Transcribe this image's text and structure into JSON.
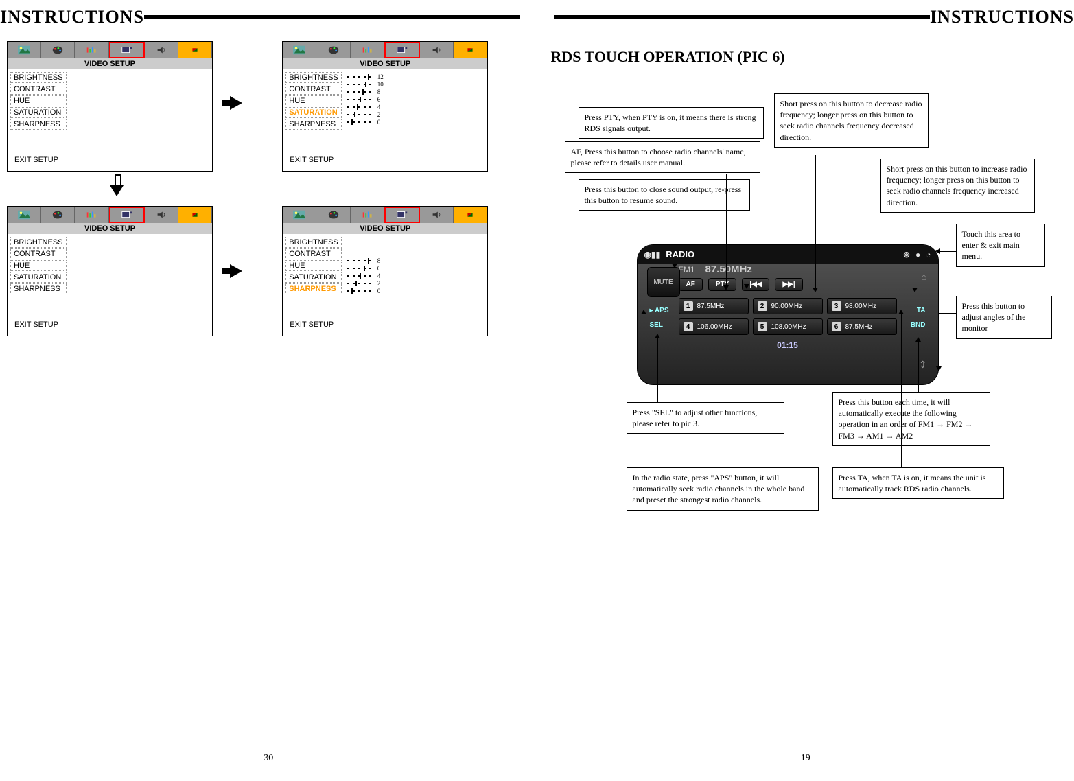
{
  "left": {
    "header": "INSTRUCTIONS",
    "page_num": "30",
    "panels": [
      {
        "title": "VIDEO SETUP",
        "items": [
          "BRIGHTNESS",
          "CONTRAST",
          "HUE",
          "SATURATION",
          "SHARPNESS"
        ],
        "selected": null,
        "exit": "EXIT SETUP",
        "bars": null
      },
      {
        "title": "VIDEO SETUP",
        "items": [
          "BRIGHTNESS",
          "CONTRAST",
          "HUE",
          "SATURATION",
          "SHARPNESS"
        ],
        "selected": 3,
        "exit": "EXIT SETUP",
        "bars": [
          "12",
          "10",
          "8",
          "6",
          "4",
          "2",
          "0"
        ]
      },
      {
        "title": "VIDEO SETUP",
        "items": [
          "BRIGHTNESS",
          "CONTRAST",
          "HUE",
          "SATURATION",
          "SHARPNESS"
        ],
        "selected": null,
        "exit": "EXIT SETUP",
        "bars": null
      },
      {
        "title": "VIDEO SETUP",
        "items": [
          "BRIGHTNESS",
          "CONTRAST",
          "HUE",
          "SATURATION",
          "SHARPNESS"
        ],
        "selected": 4,
        "exit": "EXIT SETUP",
        "bars": [
          "8",
          "6",
          "4",
          "2",
          "0"
        ]
      }
    ]
  },
  "right": {
    "header": "INSTRUCTIONS",
    "section_title": "RDS TOUCH OPERATION  (PIC 6)",
    "page_num": "19",
    "callouts": {
      "pty": "Press PTY, when PTY is on, it means there is strong RDS signals output.",
      "af": "AF, Press this button to choose radio channels' name, please refer to details user manual.",
      "mute": "Press this button to close sound output, re-press this button to resume sound.",
      "dec": "Short press on this button to decrease radio frequency; longer press on this button to seek radio channels frequency decreased direction.",
      "inc": "Short press on this button to increase radio frequency; longer press on this button to seek radio channels frequency increased direction.",
      "menu": "Touch this area to enter & exit main menu.",
      "angle": "Press this button to adjust angles of the monitor",
      "sel": "Press \"SEL\" to adjust other functions, please refer to pic 3.",
      "bnd": "Press this button each time, it will automatically execute the following operation in an order of FM1 → FM2 → FM3 → AM1 → AM2",
      "aps": "In the radio state, press \"APS\" button, it will automatically seek radio channels in the whole band and preset the strongest radio channels.",
      "ta": "Press TA, when TA is on, it means the unit is automatically track RDS radio channels."
    },
    "radio": {
      "title": "RADIO",
      "mute": "MUTE",
      "band": "FM1",
      "freq": "87.50MHz",
      "af": "AF",
      "pty": "PTY",
      "prev": "|◀◀",
      "next": "▶▶|",
      "aps": "APS",
      "sel": "SEL",
      "ta": "TA",
      "bnd": "BND",
      "clock": "01:15",
      "presets": [
        {
          "n": "1",
          "f": "87.5MHz"
        },
        {
          "n": "2",
          "f": "90.00MHz"
        },
        {
          "n": "3",
          "f": "98.00MHz"
        },
        {
          "n": "4",
          "f": "106.00MHz"
        },
        {
          "n": "5",
          "f": "108.00MHz"
        },
        {
          "n": "6",
          "f": "87.5MHz"
        }
      ]
    }
  }
}
